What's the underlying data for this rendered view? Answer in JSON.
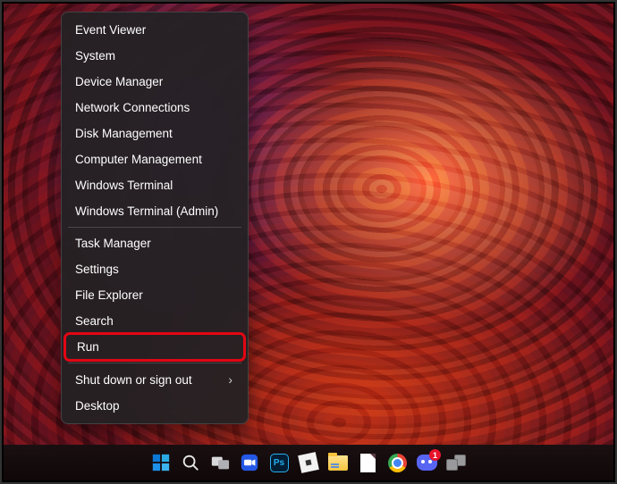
{
  "menu": {
    "groups": [
      [
        {
          "label": "Event Viewer",
          "submenu": false
        },
        {
          "label": "System",
          "submenu": false
        },
        {
          "label": "Device Manager",
          "submenu": false
        },
        {
          "label": "Network Connections",
          "submenu": false
        },
        {
          "label": "Disk Management",
          "submenu": false
        },
        {
          "label": "Computer Management",
          "submenu": false
        },
        {
          "label": "Windows Terminal",
          "submenu": false
        },
        {
          "label": "Windows Terminal (Admin)",
          "submenu": false
        }
      ],
      [
        {
          "label": "Task Manager",
          "submenu": false
        },
        {
          "label": "Settings",
          "submenu": false
        },
        {
          "label": "File Explorer",
          "submenu": false
        },
        {
          "label": "Search",
          "submenu": false
        },
        {
          "label": "Run",
          "submenu": false,
          "highlighted": true
        }
      ],
      [
        {
          "label": "Shut down or sign out",
          "submenu": true
        },
        {
          "label": "Desktop",
          "submenu": false
        }
      ]
    ]
  },
  "taskbar": {
    "icons": [
      {
        "name": "start-icon",
        "type": "start"
      },
      {
        "name": "search-icon",
        "type": "search"
      },
      {
        "name": "task-view-icon",
        "type": "taskview"
      },
      {
        "name": "video-app-icon",
        "type": "camera"
      },
      {
        "name": "photoshop-icon",
        "type": "ps",
        "text": "Ps"
      },
      {
        "name": "roblox-icon",
        "type": "roblox"
      },
      {
        "name": "file-explorer-icon",
        "type": "folder"
      },
      {
        "name": "blank-document-icon",
        "type": "page"
      },
      {
        "name": "chrome-icon",
        "type": "chrome"
      },
      {
        "name": "discord-icon",
        "type": "discord",
        "badge": "1"
      },
      {
        "name": "multitask-icon",
        "type": "stack"
      }
    ]
  }
}
